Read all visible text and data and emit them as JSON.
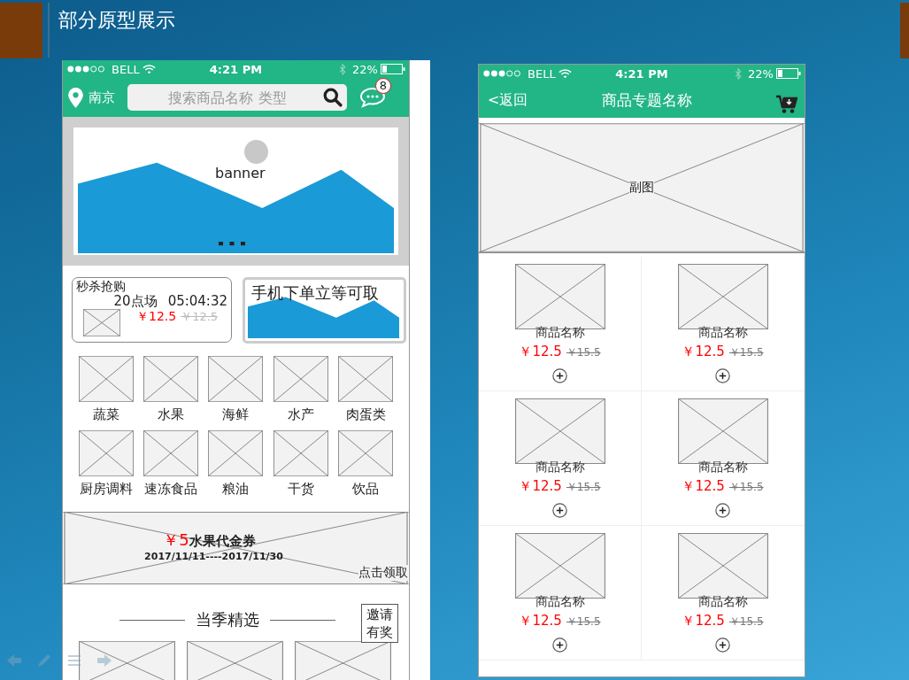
{
  "slide": {
    "title": "部分原型展示"
  },
  "home_screen": {
    "status_bar": {
      "carrier": "BELL",
      "time": "4:21 PM",
      "battery": "22%"
    },
    "header": {
      "location": "南京",
      "search_placeholder": "搜索商品名称 类型",
      "badge": "8"
    },
    "banner": {
      "label": "banner"
    },
    "flash_sale": {
      "title": "秒杀抢购",
      "session": "20点场",
      "countdown": "05:04:32",
      "price": "￥12.5",
      "old_price": "￥12.5"
    },
    "promo": {
      "text": "手机下单立等可取"
    },
    "categories": [
      {
        "label": "蔬菜"
      },
      {
        "label": "水果"
      },
      {
        "label": "海鲜"
      },
      {
        "label": "水产"
      },
      {
        "label": "肉蛋类"
      },
      {
        "label": "厨房调料"
      },
      {
        "label": "速冻食品"
      },
      {
        "label": "粮油"
      },
      {
        "label": "干货"
      },
      {
        "label": "饮品"
      }
    ],
    "coupon": {
      "amount": "￥5",
      "name": "水果代金券",
      "dates": "2017/11/11----2017/11/30",
      "action": "点击领取"
    },
    "section": {
      "title": "当季精选",
      "invite": "邀请有奖"
    }
  },
  "topic_screen": {
    "status_bar": {
      "carrier": "BELL",
      "time": "4:21 PM",
      "battery": "22%"
    },
    "header": {
      "back": "<返回",
      "title": "商品专题名称"
    },
    "hero": {
      "label": "副图"
    },
    "products": [
      {
        "name": "商品名称",
        "price": "￥12.5",
        "old_price": "￥15.5"
      },
      {
        "name": "商品名称",
        "price": "￥12.5",
        "old_price": "￥15.5"
      },
      {
        "name": "商品名称",
        "price": "￥12.5",
        "old_price": "￥15.5"
      },
      {
        "name": "商品名称",
        "price": "￥12.5",
        "old_price": "￥15.5"
      },
      {
        "name": "商品名称",
        "price": "￥12.5",
        "old_price": "￥15.5"
      },
      {
        "name": "商品名称",
        "price": "￥12.5",
        "old_price": "￥15.5"
      }
    ]
  }
}
